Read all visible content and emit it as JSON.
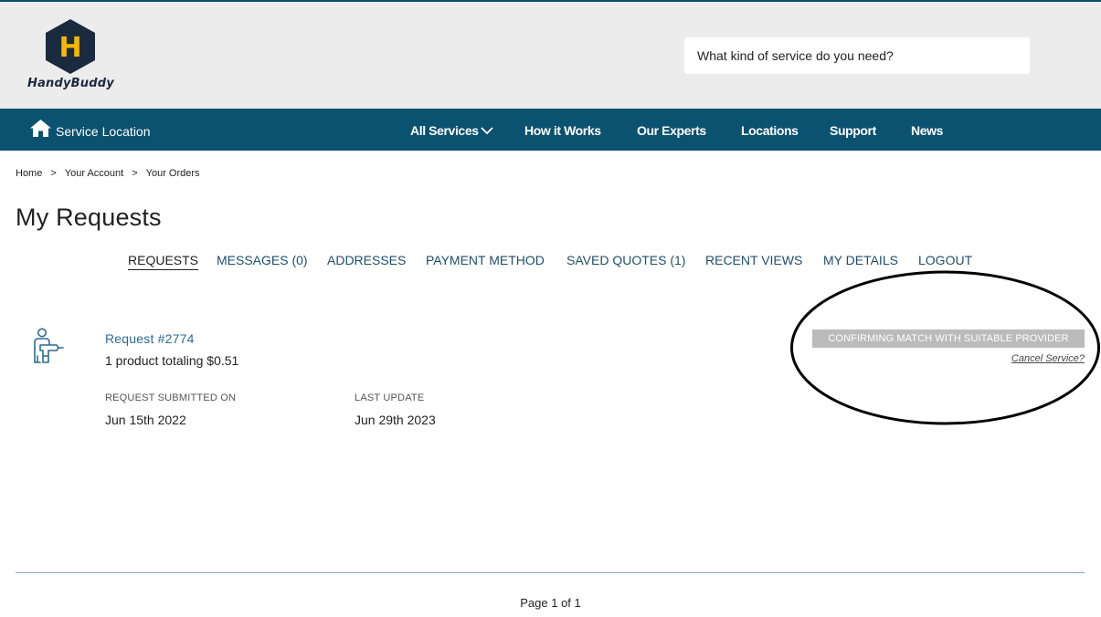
{
  "brand": {
    "name": "HandyBuddy",
    "logo_letter": "H",
    "colors": {
      "navy": "#1a2a3f",
      "gold": "#f5b800",
      "nav": "#0b5170"
    }
  },
  "search": {
    "placeholder": "What kind of service do you need?"
  },
  "nav": {
    "location_label": "Service Location",
    "location_icon": "home-icon",
    "items": [
      {
        "label": "All Services",
        "has_dropdown": true
      },
      {
        "label": "How it Works"
      },
      {
        "label": "Our Experts"
      },
      {
        "label": "Locations"
      },
      {
        "label": "Support"
      },
      {
        "label": "News"
      }
    ]
  },
  "breadcrumb": {
    "items": [
      "Home",
      "Your Account",
      "Your Orders"
    ],
    "separator": ">"
  },
  "page_title": "My Requests",
  "tabs": [
    {
      "label": "REQUESTS",
      "active": true
    },
    {
      "label": "MESSAGES (0)"
    },
    {
      "label": "ADDRESSES"
    },
    {
      "label": "PAYMENT METHOD"
    },
    {
      "label": "SAVED QUOTES (1)"
    },
    {
      "label": "RECENT VIEWS"
    },
    {
      "label": "MY DETAILS"
    },
    {
      "label": "LOGOUT"
    }
  ],
  "request": {
    "icon": "handyman-drill-icon",
    "title": "Request #2774",
    "summary": "1 product totaling $0.51",
    "submitted_label": "REQUEST SUBMITTED ON",
    "submitted_value": "Jun 15th 2022",
    "updated_label": "LAST UPDATE",
    "updated_value": "Jun 29th 2023",
    "status": "CONFIRMING MATCH WITH SUITABLE PROVIDER",
    "cancel_label": "Cancel Service?"
  },
  "pagination": {
    "text": "Page 1 of 1"
  }
}
